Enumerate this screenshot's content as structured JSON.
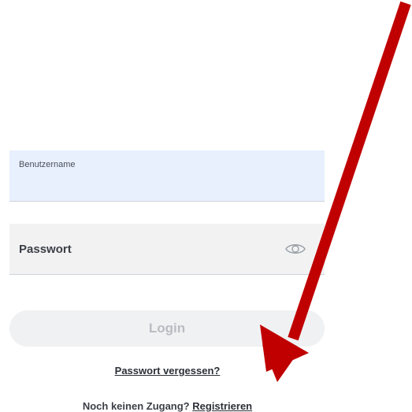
{
  "login_form": {
    "username_label": "Benutzername",
    "username_value": "",
    "password_placeholder": "Passwort",
    "password_value": "",
    "show_password_icon": "eye-icon",
    "login_label": "Login",
    "forgot_password_label": "Passwort vergessen?",
    "no_account_text": "Noch keinen Zugang?",
    "register_label": "Registrieren"
  },
  "annotation": {
    "arrow_color": "#c00000",
    "arrow_icon": "arrow-annotation"
  },
  "colors": {
    "username_field_bg": "#e8f0fe",
    "password_field_bg": "#f2f2f3",
    "login_button_bg": "#f0f1f2",
    "login_button_text": "#b8bcc2"
  }
}
